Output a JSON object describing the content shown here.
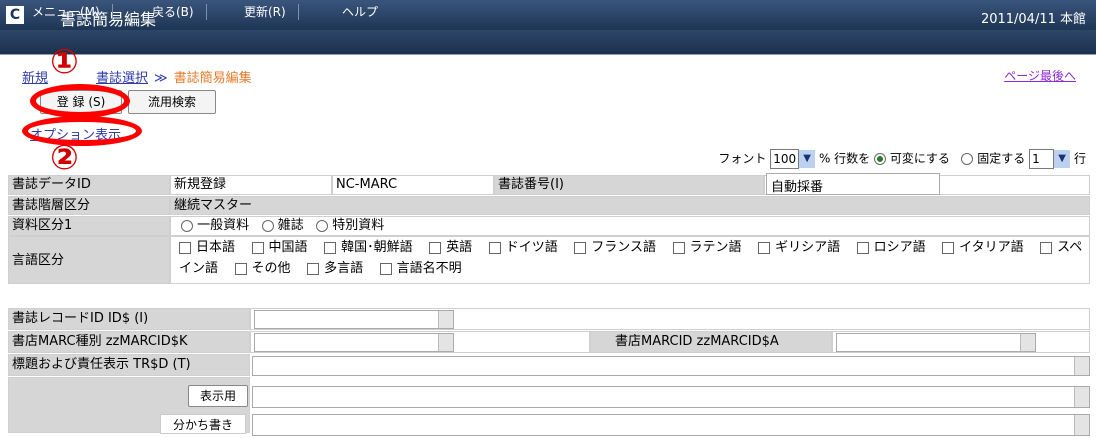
{
  "app": {
    "logo": "C",
    "title": "書誌簡易編集",
    "date_branch": "2011/04/11 本館"
  },
  "menu": [
    "メニュー(M)",
    "戻る(B)",
    "更新(R)",
    "ヘルプ"
  ],
  "breadcrumb": {
    "item1": "新規",
    "item2": "書誌選択",
    "sep": "≫",
    "current": "書誌簡易編集"
  },
  "page_end": "ページ最後へ",
  "buttons": {
    "register": "登 録 (S)",
    "reuse_search": "流用検索"
  },
  "option_link": "オプション表示",
  "annotations": {
    "one": "①",
    "two": "②"
  },
  "font_row": {
    "font_label": "フォント",
    "font_size": "100",
    "percent_label": "% 行数を",
    "variable": "可変にする",
    "fixed": "固定する",
    "rows": "1",
    "row_unit": "行"
  },
  "record": {
    "id_label": "書誌データID",
    "id_value": "新規登録",
    "marc_value": "NC-MARC",
    "number_label": "書誌番号(I)",
    "number_value": "自動採番",
    "hierarchy_label": "書誌階層区分",
    "hierarchy_value": "継続マスター",
    "material_label": "資料区分1",
    "material_options": [
      "一般資料",
      "雑誌",
      "特別資料"
    ],
    "language_label": "言語区分",
    "languages": [
      "日本語",
      "中国語",
      "韓国･朝鮮語",
      "英語",
      "ドイツ語",
      "フランス語",
      "ラテン語",
      "ギリシア語",
      "ロシア語",
      "イタリア語",
      "スペイン語",
      "その他",
      "多言語",
      "言語名不明"
    ]
  },
  "fields": {
    "record_id": "書誌レコードID ID$ (I)",
    "marc_type": "書店MARC種別 zzMARCID$K",
    "marc_id": "書店MARCID zzMARCID$A",
    "title": "標題および責任表示 TR$D (T)",
    "display": "表示用",
    "separation": "分かち書き"
  },
  "colors": {
    "titlebar": "#1e3554",
    "accent_orange": "#e57b2a",
    "link": "#2f3ca8",
    "annotation_red": "#ff0000"
  }
}
